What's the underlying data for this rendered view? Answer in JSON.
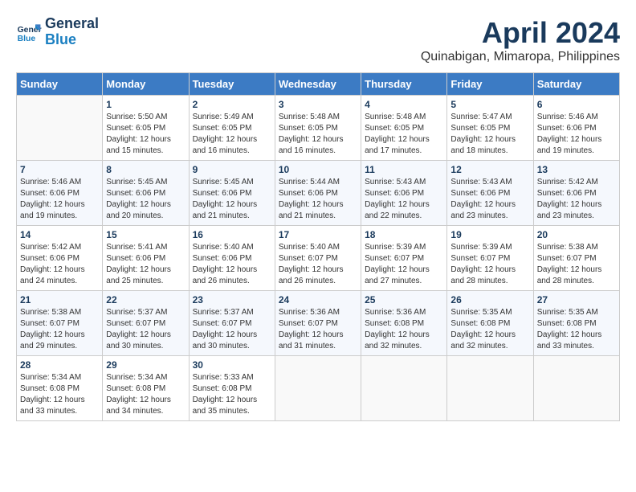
{
  "header": {
    "logo_line1": "General",
    "logo_line2": "Blue",
    "month": "April 2024",
    "location": "Quinabigan, Mimaropa, Philippines"
  },
  "weekdays": [
    "Sunday",
    "Monday",
    "Tuesday",
    "Wednesday",
    "Thursday",
    "Friday",
    "Saturday"
  ],
  "weeks": [
    [
      {
        "day": "",
        "info": ""
      },
      {
        "day": "1",
        "info": "Sunrise: 5:50 AM\nSunset: 6:05 PM\nDaylight: 12 hours\nand 15 minutes."
      },
      {
        "day": "2",
        "info": "Sunrise: 5:49 AM\nSunset: 6:05 PM\nDaylight: 12 hours\nand 16 minutes."
      },
      {
        "day": "3",
        "info": "Sunrise: 5:48 AM\nSunset: 6:05 PM\nDaylight: 12 hours\nand 16 minutes."
      },
      {
        "day": "4",
        "info": "Sunrise: 5:48 AM\nSunset: 6:05 PM\nDaylight: 12 hours\nand 17 minutes."
      },
      {
        "day": "5",
        "info": "Sunrise: 5:47 AM\nSunset: 6:05 PM\nDaylight: 12 hours\nand 18 minutes."
      },
      {
        "day": "6",
        "info": "Sunrise: 5:46 AM\nSunset: 6:06 PM\nDaylight: 12 hours\nand 19 minutes."
      }
    ],
    [
      {
        "day": "7",
        "info": "Sunrise: 5:46 AM\nSunset: 6:06 PM\nDaylight: 12 hours\nand 19 minutes."
      },
      {
        "day": "8",
        "info": "Sunrise: 5:45 AM\nSunset: 6:06 PM\nDaylight: 12 hours\nand 20 minutes."
      },
      {
        "day": "9",
        "info": "Sunrise: 5:45 AM\nSunset: 6:06 PM\nDaylight: 12 hours\nand 21 minutes."
      },
      {
        "day": "10",
        "info": "Sunrise: 5:44 AM\nSunset: 6:06 PM\nDaylight: 12 hours\nand 21 minutes."
      },
      {
        "day": "11",
        "info": "Sunrise: 5:43 AM\nSunset: 6:06 PM\nDaylight: 12 hours\nand 22 minutes."
      },
      {
        "day": "12",
        "info": "Sunrise: 5:43 AM\nSunset: 6:06 PM\nDaylight: 12 hours\nand 23 minutes."
      },
      {
        "day": "13",
        "info": "Sunrise: 5:42 AM\nSunset: 6:06 PM\nDaylight: 12 hours\nand 23 minutes."
      }
    ],
    [
      {
        "day": "14",
        "info": "Sunrise: 5:42 AM\nSunset: 6:06 PM\nDaylight: 12 hours\nand 24 minutes."
      },
      {
        "day": "15",
        "info": "Sunrise: 5:41 AM\nSunset: 6:06 PM\nDaylight: 12 hours\nand 25 minutes."
      },
      {
        "day": "16",
        "info": "Sunrise: 5:40 AM\nSunset: 6:06 PM\nDaylight: 12 hours\nand 26 minutes."
      },
      {
        "day": "17",
        "info": "Sunrise: 5:40 AM\nSunset: 6:07 PM\nDaylight: 12 hours\nand 26 minutes."
      },
      {
        "day": "18",
        "info": "Sunrise: 5:39 AM\nSunset: 6:07 PM\nDaylight: 12 hours\nand 27 minutes."
      },
      {
        "day": "19",
        "info": "Sunrise: 5:39 AM\nSunset: 6:07 PM\nDaylight: 12 hours\nand 28 minutes."
      },
      {
        "day": "20",
        "info": "Sunrise: 5:38 AM\nSunset: 6:07 PM\nDaylight: 12 hours\nand 28 minutes."
      }
    ],
    [
      {
        "day": "21",
        "info": "Sunrise: 5:38 AM\nSunset: 6:07 PM\nDaylight: 12 hours\nand 29 minutes."
      },
      {
        "day": "22",
        "info": "Sunrise: 5:37 AM\nSunset: 6:07 PM\nDaylight: 12 hours\nand 30 minutes."
      },
      {
        "day": "23",
        "info": "Sunrise: 5:37 AM\nSunset: 6:07 PM\nDaylight: 12 hours\nand 30 minutes."
      },
      {
        "day": "24",
        "info": "Sunrise: 5:36 AM\nSunset: 6:07 PM\nDaylight: 12 hours\nand 31 minutes."
      },
      {
        "day": "25",
        "info": "Sunrise: 5:36 AM\nSunset: 6:08 PM\nDaylight: 12 hours\nand 32 minutes."
      },
      {
        "day": "26",
        "info": "Sunrise: 5:35 AM\nSunset: 6:08 PM\nDaylight: 12 hours\nand 32 minutes."
      },
      {
        "day": "27",
        "info": "Sunrise: 5:35 AM\nSunset: 6:08 PM\nDaylight: 12 hours\nand 33 minutes."
      }
    ],
    [
      {
        "day": "28",
        "info": "Sunrise: 5:34 AM\nSunset: 6:08 PM\nDaylight: 12 hours\nand 33 minutes."
      },
      {
        "day": "29",
        "info": "Sunrise: 5:34 AM\nSunset: 6:08 PM\nDaylight: 12 hours\nand 34 minutes."
      },
      {
        "day": "30",
        "info": "Sunrise: 5:33 AM\nSunset: 6:08 PM\nDaylight: 12 hours\nand 35 minutes."
      },
      {
        "day": "",
        "info": ""
      },
      {
        "day": "",
        "info": ""
      },
      {
        "day": "",
        "info": ""
      },
      {
        "day": "",
        "info": ""
      }
    ]
  ]
}
